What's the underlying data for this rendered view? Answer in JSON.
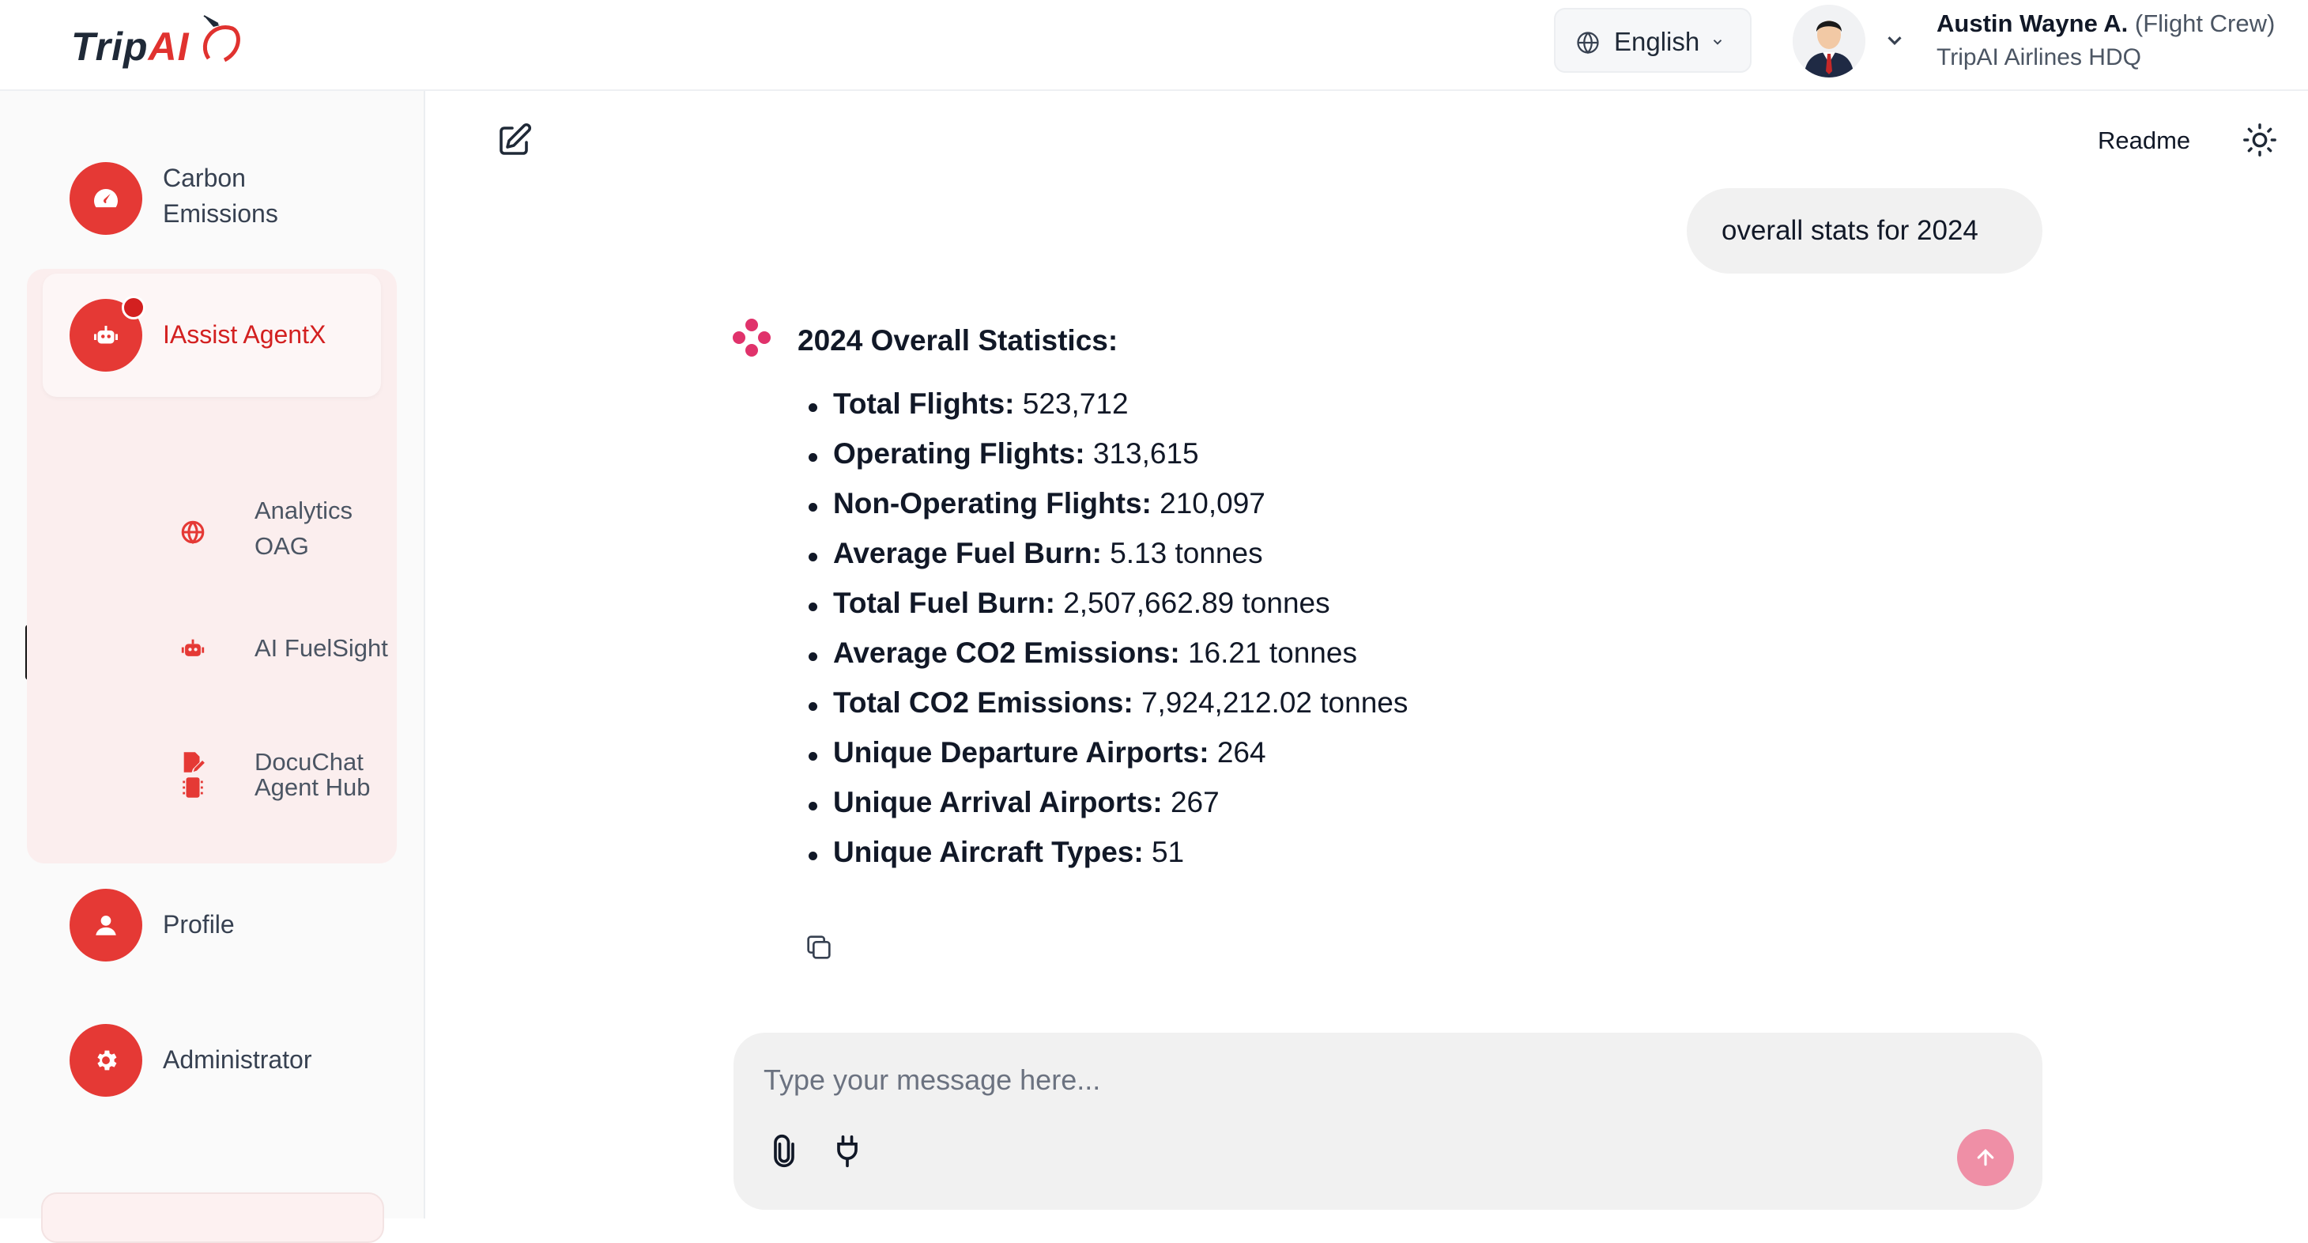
{
  "brand": {
    "logo_text_a": "Trip",
    "logo_text_b": "AI"
  },
  "header": {
    "language": "English",
    "user_name": "Austin Wayne A.",
    "user_role": "(Flight Crew)",
    "user_org": "TripAI Airlines HDQ"
  },
  "sidebar": {
    "items": [
      {
        "label": "Carbon Emissions",
        "icon": "speedometer-icon"
      },
      {
        "label": "IAssist AgentX",
        "icon": "robot-icon",
        "active": true
      },
      {
        "label": "Profile",
        "icon": "user-icon"
      },
      {
        "label": "Administrator",
        "icon": "gear-icon"
      }
    ],
    "sub_items": [
      {
        "label_line1": "Analytics",
        "label_line2": "OAG",
        "icon": "globe-icon"
      },
      {
        "label": "AI FuelSight",
        "icon": "robot-icon"
      },
      {
        "label": "DocuChat",
        "icon": "document-edit-icon"
      },
      {
        "label": "Agent Hub",
        "icon": "chip-icon"
      }
    ]
  },
  "toolbar": {
    "readme": "Readme"
  },
  "chat": {
    "user_message": "overall stats for 2024",
    "bot_title": "2024 Overall Statistics:",
    "stats": [
      {
        "label": "Total Flights:",
        "value": "523,712"
      },
      {
        "label": "Operating Flights:",
        "value": "313,615"
      },
      {
        "label": "Non-Operating Flights:",
        "value": "210,097"
      },
      {
        "label": "Average Fuel Burn:",
        "value": "5.13 tonnes"
      },
      {
        "label": "Total Fuel Burn:",
        "value": "2,507,662.89 tonnes"
      },
      {
        "label": "Average CO2 Emissions:",
        "value": "16.21 tonnes"
      },
      {
        "label": "Total CO2 Emissions:",
        "value": "7,924,212.02 tonnes"
      },
      {
        "label": "Unique Departure Airports:",
        "value": "264"
      },
      {
        "label": "Unique Arrival Airports:",
        "value": "267"
      },
      {
        "label": "Unique Aircraft Types:",
        "value": "51"
      }
    ]
  },
  "composer": {
    "placeholder": "Type your message here..."
  },
  "colors": {
    "accent": "#e53935",
    "send_button": "#ef8fa6",
    "sidebar_group_bg": "#fbeeee"
  }
}
